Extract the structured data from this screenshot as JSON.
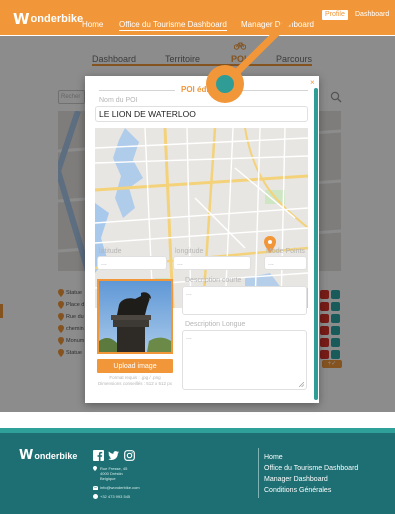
{
  "brand": {
    "logo_mark": "W",
    "logo_word": "onderbike"
  },
  "nav": {
    "home": "Home",
    "office": "Office du Tourisme Dashboard",
    "manager": "Manager Dashboard",
    "profile": "Profile",
    "dashboard": "Dashboard"
  },
  "tabs": [
    {
      "label": "Dashboard"
    },
    {
      "label": "Territoire"
    },
    {
      "label": "POI"
    },
    {
      "label": "Parcours"
    }
  ],
  "background": {
    "search_placeholder": "Recher",
    "poi_items": [
      "Statue",
      "Place d",
      "Rue du",
      "chemin",
      "Monum",
      "Statue"
    ]
  },
  "modal": {
    "title": "POI édit",
    "close": "×",
    "name_label": "Nom du POI",
    "name_value": "LE LION DE WATERLOO",
    "latitude_label": "latitude",
    "latitude_value": "...",
    "longitude_label": "longitude",
    "longitude_value": "...",
    "points_label": "Mode Points",
    "points_value": "...",
    "short_desc_label": "Description courte",
    "short_desc_value": "...",
    "long_desc_label": "Description Longue",
    "long_desc_value": "...",
    "upload_label": "Upload image",
    "upload_hint_1": "Format requis : .jpg / .png",
    "upload_hint_2": "Dimensions conseillés : 512 x 512 px"
  },
  "footer": {
    "address": "Rue Fresse, 45\n4000 Dréstin\nBelgique",
    "email": "info@wonderbike.com",
    "phone": "+32 473 993 545",
    "links": [
      "Home",
      "Office du Tourisme Dashboard",
      "Manager Dashboard",
      "Conditions Générales"
    ]
  },
  "colors": {
    "accent": "#f1973a",
    "teal": "#1d6f73",
    "danger": "#d9342b"
  },
  "icons": {
    "bike": "bike-icon",
    "search": "search-icon",
    "pin": "map-pin-icon",
    "facebook": "facebook-icon",
    "twitter": "twitter-icon",
    "instagram": "instagram-icon"
  }
}
